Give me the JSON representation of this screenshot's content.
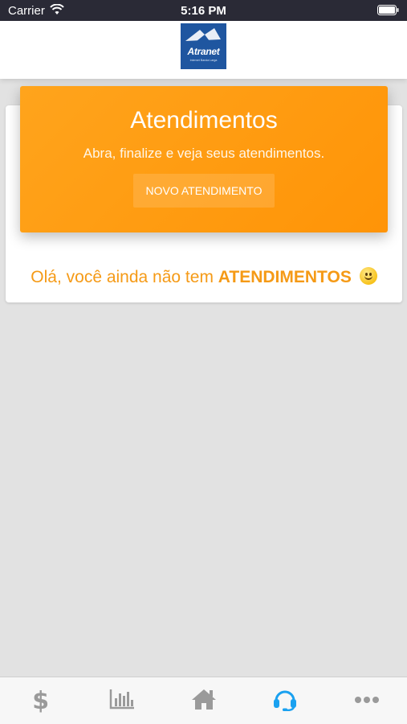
{
  "status_bar": {
    "carrier": "Carrier",
    "time": "5:16 PM"
  },
  "header": {
    "logo_text": "Atranet",
    "logo_subtext": "Internet Banda Larga"
  },
  "banner": {
    "title": "Atendimentos",
    "subtitle": "Abra, finalize e veja seus atendimentos.",
    "button_label": "NOVO ATENDIMENTO"
  },
  "empty_state": {
    "text_prefix": "Olá, você ainda não tem ",
    "text_emphasis": "ATENDIMENTOS"
  },
  "tab_bar": {
    "items": [
      {
        "icon": "dollar-icon",
        "active": false
      },
      {
        "icon": "bar-chart-icon",
        "active": false
      },
      {
        "icon": "home-icon",
        "active": false
      },
      {
        "icon": "headset-icon",
        "active": true
      },
      {
        "icon": "more-icon",
        "active": false
      }
    ],
    "active_color": "#1aa1f0",
    "inactive_color": "#9a9a9a"
  },
  "colors": {
    "accent": "#ff9c12",
    "status_bar": "#2a2a36",
    "background": "#e2e2e2"
  }
}
